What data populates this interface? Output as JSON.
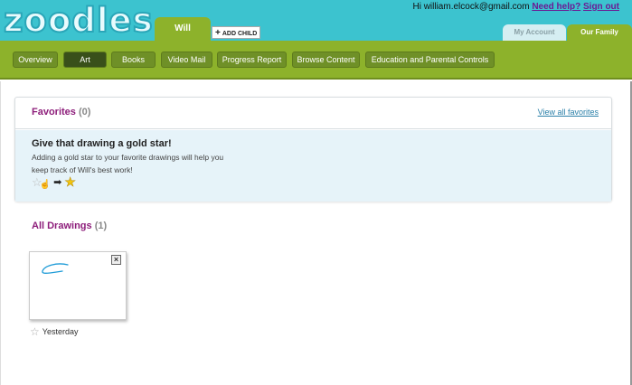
{
  "brand": {
    "logo_text": "zoodles"
  },
  "child": {
    "name": "Will",
    "add_label": "ADD CHILD"
  },
  "account": {
    "greeting": "Hi william.elcock@gmail.com",
    "help": "Need help?",
    "signout": "Sign out",
    "tabs": [
      {
        "label": "My Account"
      },
      {
        "label": "Our Family"
      }
    ]
  },
  "nav": {
    "items": [
      {
        "label": "Overview"
      },
      {
        "label": "Art"
      },
      {
        "label": "Books"
      },
      {
        "label": "Video Mail"
      },
      {
        "label": "Progress Report"
      },
      {
        "label": "Browse Content"
      },
      {
        "label": "Education and Parental Controls"
      }
    ],
    "active": "Art"
  },
  "favorites": {
    "title": "Favorites",
    "count": "(0)",
    "view_all": "View all favorites",
    "tip_title": "Give that drawing a gold star!",
    "tip_line1": "Adding a gold star to your favorite drawings will help you",
    "tip_line2": "keep track of Will's best work!"
  },
  "drawings": {
    "title": "All Drawings",
    "count": "(1)",
    "items": [
      {
        "caption": "Yesterday"
      }
    ]
  },
  "colors": {
    "header_bg": "#3cc3cf",
    "nav_bg": "#8db22b",
    "section_title": "#8d1d7a",
    "link": "#2a7fa8"
  },
  "icons": [
    "plus-icon",
    "star-outline-icon",
    "cursor-hand-icon",
    "arrow-right-icon",
    "star-gold-icon",
    "close-icon"
  ]
}
